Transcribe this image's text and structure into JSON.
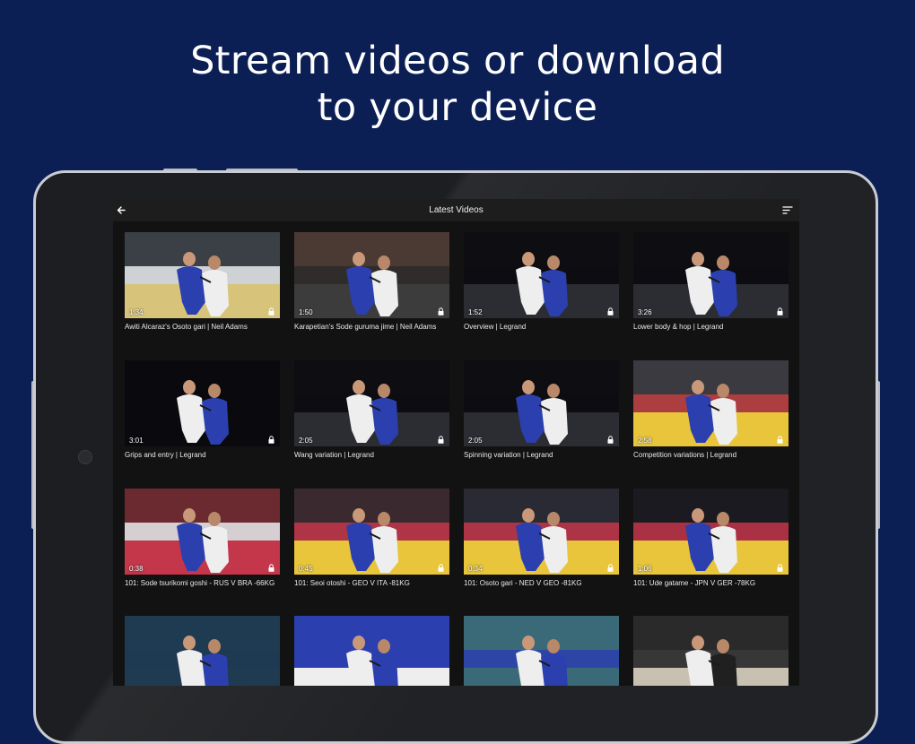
{
  "promo": {
    "headline_line1": "Stream videos or download",
    "headline_line2": "to your device"
  },
  "app": {
    "title": "Latest Videos",
    "back_icon": "arrow-left-icon",
    "sort_icon": "sort-icon"
  },
  "videos": [
    {
      "duration": "1:34",
      "title": "Awiti Alcaraz's Osoto gari | Neil Adams",
      "locked": true
    },
    {
      "duration": "1:50",
      "title": "Karapetian's Sode guruma jime | Neil Adams",
      "locked": true
    },
    {
      "duration": "1:52",
      "title": "Overview | Legrand",
      "locked": true
    },
    {
      "duration": "3:26",
      "title": "Lower body & hop | Legrand",
      "locked": true
    },
    {
      "duration": "3:01",
      "title": "Grips and entry | Legrand",
      "locked": true
    },
    {
      "duration": "2:05",
      "title": "Wang variation | Legrand",
      "locked": true
    },
    {
      "duration": "2:05",
      "title": "Spinning variation | Legrand",
      "locked": true
    },
    {
      "duration": "2:58",
      "title": "Competition variations | Legrand",
      "locked": true
    },
    {
      "duration": "0:38",
      "title": "101: Sode tsurikomi goshi - RUS V BRA -66KG",
      "locked": true
    },
    {
      "duration": "0:45",
      "title": "101: Seoi otoshi - GEO V ITA -81KG",
      "locked": true
    },
    {
      "duration": "0:34",
      "title": "101: Osoto gari - NED V GEO -81KG",
      "locked": true
    },
    {
      "duration": "1:06",
      "title": "101: Ude gatame - JPN V GER -78KG",
      "locked": true
    },
    {
      "duration": "",
      "title": "",
      "locked": false
    },
    {
      "duration": "",
      "title": "",
      "locked": false
    },
    {
      "duration": "",
      "title": "",
      "locked": false
    },
    {
      "duration": "",
      "title": "",
      "locked": false
    }
  ],
  "colors": {
    "background": "#0b1f54",
    "device_frame": "#1d1e21",
    "screen": "#121212",
    "appbar": "#1d1d1d",
    "judogi_blue": "#2b3fae",
    "judogi_white": "#eeeeee",
    "mat_yellow": "#e8c53a",
    "mat_red": "#c4364a"
  }
}
